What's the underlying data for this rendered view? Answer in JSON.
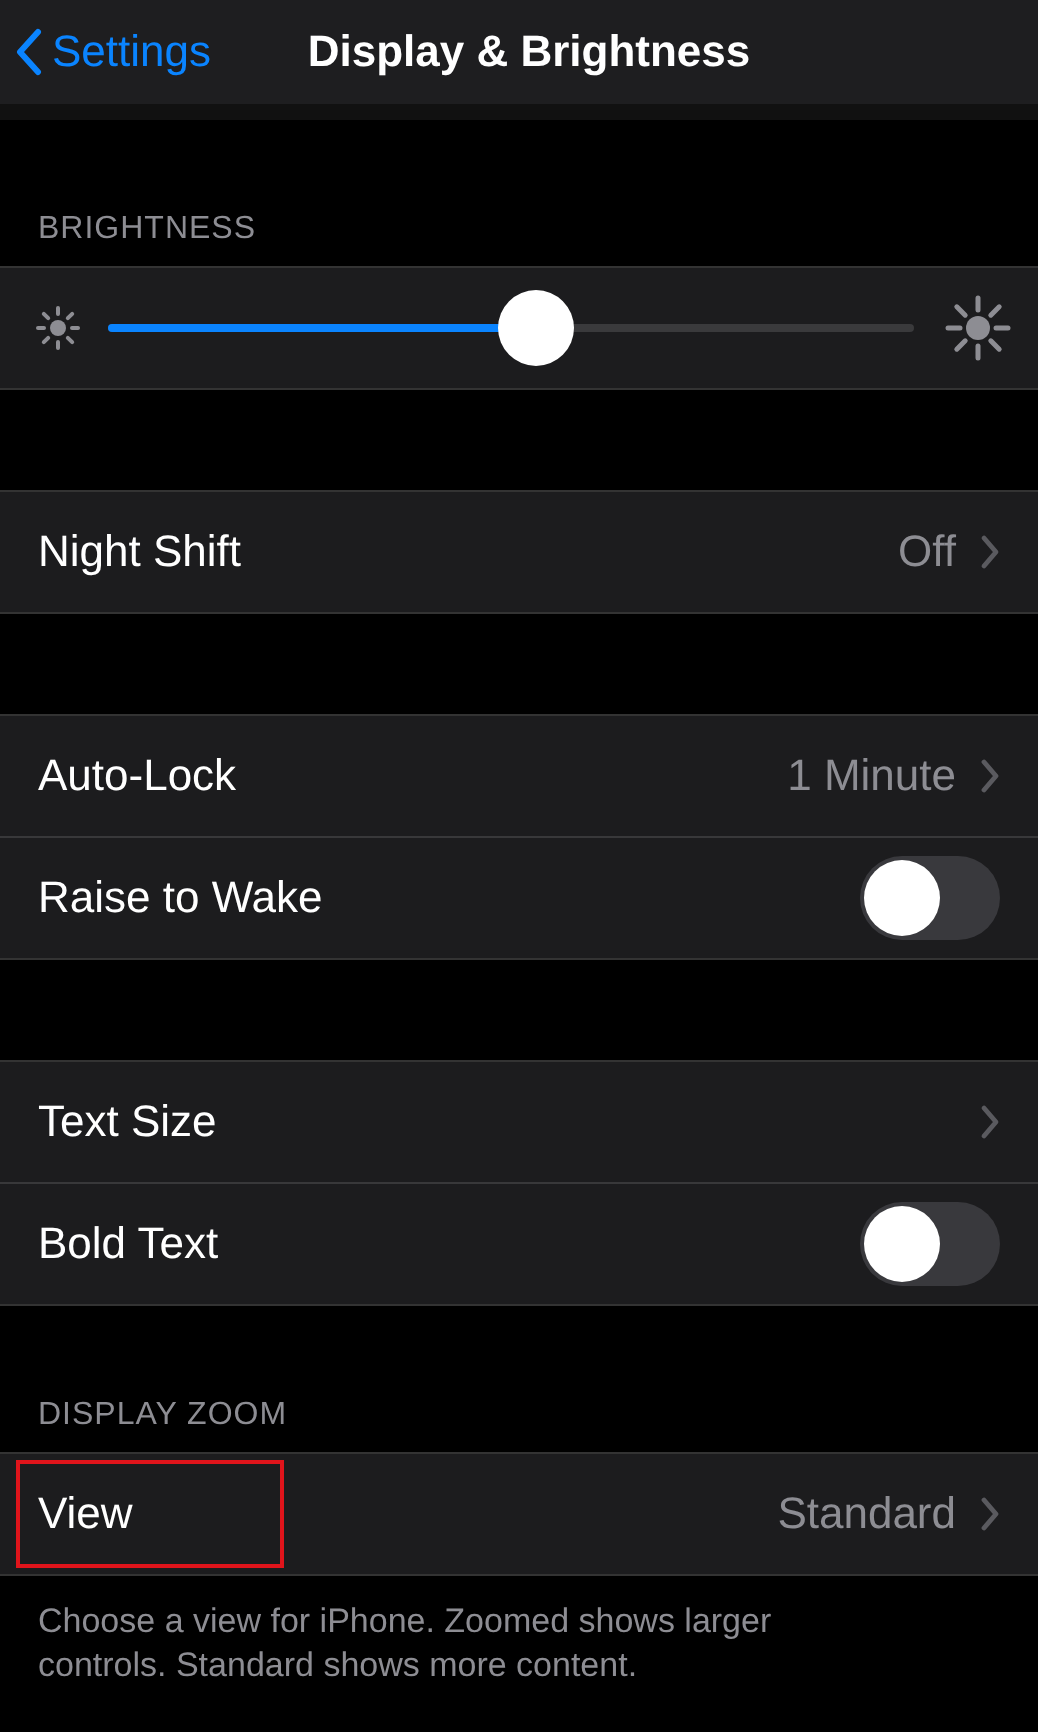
{
  "nav": {
    "back_label": "Settings",
    "title": "Display & Brightness"
  },
  "sections": [
    {
      "header": "BRIGHTNESS",
      "rows": [
        {
          "kind": "slider",
          "level": 0.53
        }
      ]
    },
    {
      "rows": [
        {
          "kind": "link",
          "label": "Night Shift",
          "value": "Off",
          "highlighted": false
        }
      ]
    },
    {
      "rows": [
        {
          "kind": "link",
          "label": "Auto-Lock",
          "value": "1 Minute",
          "highlighted": false
        },
        {
          "kind": "toggle",
          "label": "Raise to Wake",
          "on": false
        }
      ]
    },
    {
      "rows": [
        {
          "kind": "link",
          "label": "Text Size",
          "highlighted": false
        },
        {
          "kind": "toggle",
          "label": "Bold Text",
          "on": false
        }
      ]
    },
    {
      "header": "DISPLAY ZOOM",
      "rows": [
        {
          "kind": "link",
          "label": "View",
          "value": "Standard",
          "highlighted": true
        }
      ],
      "footer": "Choose a view for iPhone. Zoomed shows larger controls. Standard shows more content."
    }
  ]
}
